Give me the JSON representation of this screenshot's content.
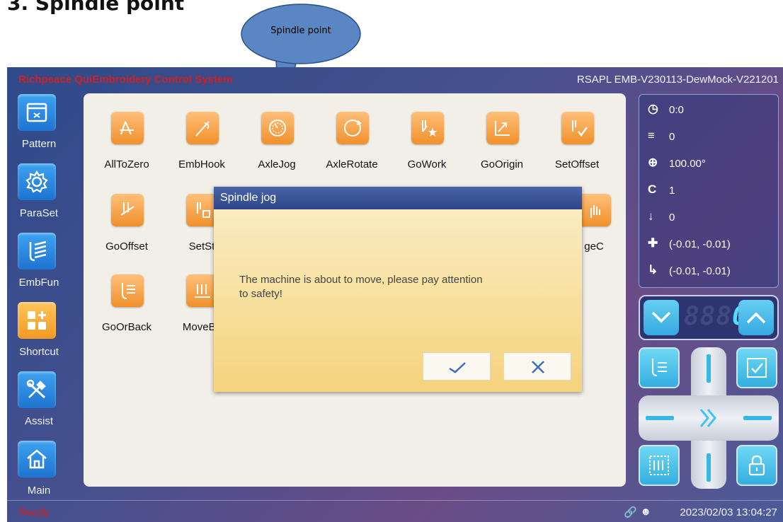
{
  "doc": {
    "heading": "3. Spindle point",
    "callout": "Spindle point"
  },
  "titlebar": {
    "app_title": "Richpeace QuiEmbroidery Control System",
    "version": "RSAPL EMB-V230113-DewMock-V221201"
  },
  "nav": {
    "items": [
      {
        "label": "Pattern",
        "icon": "folder-icon"
      },
      {
        "label": "ParaSet",
        "icon": "gear-icon"
      },
      {
        "label": "EmbFun",
        "icon": "needle-icon"
      },
      {
        "label": "Shortcut",
        "icon": "grid-plus-icon"
      },
      {
        "label": "Assist",
        "icon": "tools-icon"
      },
      {
        "label": "Main",
        "icon": "home-icon"
      }
    ]
  },
  "functions": {
    "row1": [
      "AllToZero",
      "EmbHook",
      "AxleJog",
      "AxleRotate",
      "GoWork",
      "GoOrigin",
      "SetOffset"
    ],
    "row2": [
      "GoOffset",
      "SetSt",
      "geC"
    ],
    "row3": [
      "GoOrBack",
      "MoveBc"
    ]
  },
  "dialog": {
    "title": "Spindle jog",
    "message": "The machine is about to move, please pay attention to safety!",
    "confirm_icon": "check-icon",
    "cancel_icon": "close-icon"
  },
  "status": {
    "time": "0:0",
    "stitches": "0",
    "angle": "100.00°",
    "color": "1",
    "needle": "0",
    "position": "(-0.01, -0.01)",
    "origin": "(-0.01, -0.01)"
  },
  "counter": {
    "dim_digits": "888",
    "value": "0"
  },
  "footer": {
    "status": "Ready",
    "datetime": "2023/02/03 13:04:27"
  },
  "colors": {
    "accent": "#f39a22",
    "nav_blue": "#1e73d0",
    "status_red": "#d02020",
    "dialog_title": "#2c4787"
  }
}
